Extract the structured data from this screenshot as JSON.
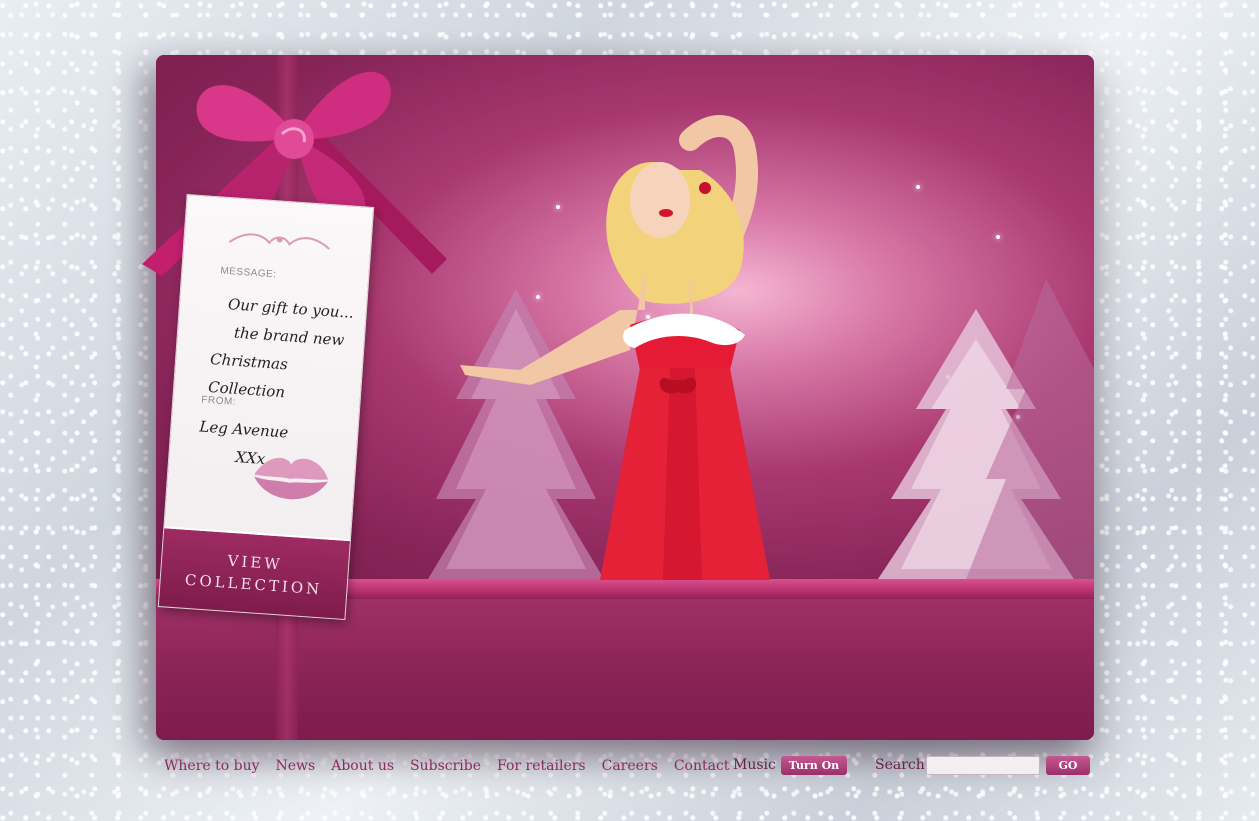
{
  "tag": {
    "message_label": "MESSAGE:",
    "message_line1": "Our gift to you...",
    "message_line2": "the brand new",
    "message_line3": "Christmas Collection",
    "from_label": "FROM:",
    "from_name": "Leg Avenue",
    "kisses": "XXx",
    "button_line1": "VIEW",
    "button_line2": "COLLECTION"
  },
  "nav": {
    "items": [
      {
        "label": "Where to buy"
      },
      {
        "label": "News"
      },
      {
        "label": "About us"
      },
      {
        "label": "Subscribe"
      },
      {
        "label": "For retailers"
      },
      {
        "label": "Careers"
      },
      {
        "label": "Contact"
      }
    ]
  },
  "music": {
    "label": "Music",
    "button": "Turn On"
  },
  "search": {
    "label": "Search",
    "placeholder": "",
    "value": "",
    "button": "GO"
  },
  "colors": {
    "brand": "#8c2a63",
    "accent": "#c35a90",
    "ribbon": "#d9508f"
  }
}
